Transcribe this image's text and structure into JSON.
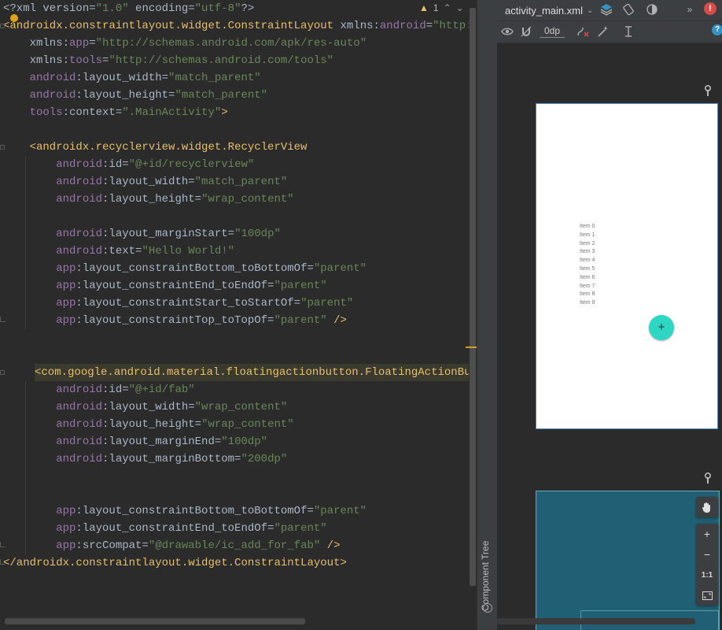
{
  "editor": {
    "lines": [
      [
        {
          "t": "<?xml version=",
          "c": "def"
        },
        {
          "t": "\"1.0\"",
          "c": "str"
        },
        {
          "t": " encoding=",
          "c": "def"
        },
        {
          "t": "\"utf-8\"",
          "c": "str"
        },
        {
          "t": "?>",
          "c": "def"
        }
      ],
      [
        {
          "t": "<androidx.constraintlayout.widget.ConstraintLayout ",
          "c": "tag"
        },
        {
          "t": "xmlns:",
          "c": "def"
        },
        {
          "t": "android",
          "c": "ns"
        },
        {
          "t": "=",
          "c": "def"
        },
        {
          "t": "\"http://sch",
          "c": "str"
        }
      ],
      [
        {
          "t": "    xmlns:",
          "c": "def"
        },
        {
          "t": "app",
          "c": "ns"
        },
        {
          "t": "=",
          "c": "def"
        },
        {
          "t": "\"http://schemas.android.com/apk/res-auto\"",
          "c": "str"
        }
      ],
      [
        {
          "t": "    xmlns:",
          "c": "def"
        },
        {
          "t": "tools",
          "c": "ns"
        },
        {
          "t": "=",
          "c": "def"
        },
        {
          "t": "\"http://schemas.android.com/tools\"",
          "c": "str"
        }
      ],
      [
        {
          "t": "    android",
          "c": "ns"
        },
        {
          "t": ":layout_width=",
          "c": "def"
        },
        {
          "t": "\"match_parent\"",
          "c": "str"
        }
      ],
      [
        {
          "t": "    android",
          "c": "ns"
        },
        {
          "t": ":layout_height=",
          "c": "def"
        },
        {
          "t": "\"match_parent\"",
          "c": "str"
        }
      ],
      [
        {
          "t": "    tools",
          "c": "ns"
        },
        {
          "t": ":context=",
          "c": "def"
        },
        {
          "t": "\".MainActivity\"",
          "c": "str"
        },
        {
          "t": ">",
          "c": "tag"
        }
      ],
      [],
      [
        {
          "t": "    <androidx.recyclerview.widget.RecyclerView",
          "c": "tag"
        }
      ],
      [
        {
          "t": "        android",
          "c": "ns"
        },
        {
          "t": ":id=",
          "c": "def"
        },
        {
          "t": "\"@+id/recyclerview\"",
          "c": "str"
        }
      ],
      [
        {
          "t": "        android",
          "c": "ns"
        },
        {
          "t": ":layout_width=",
          "c": "def"
        },
        {
          "t": "\"match_parent\"",
          "c": "str"
        }
      ],
      [
        {
          "t": "        android",
          "c": "ns"
        },
        {
          "t": ":layout_height=",
          "c": "def"
        },
        {
          "t": "\"wrap_content\"",
          "c": "str"
        }
      ],
      [],
      [
        {
          "t": "        android",
          "c": "ns"
        },
        {
          "t": ":layout_marginStart=",
          "c": "def"
        },
        {
          "t": "\"100dp\"",
          "c": "str"
        }
      ],
      [
        {
          "t": "        android",
          "c": "ns"
        },
        {
          "t": ":text=",
          "c": "def"
        },
        {
          "t": "\"Hello World!\"",
          "c": "str"
        }
      ],
      [
        {
          "t": "        app",
          "c": "ns"
        },
        {
          "t": ":layout_constraintBottom_toBottomOf=",
          "c": "def"
        },
        {
          "t": "\"parent\"",
          "c": "str"
        }
      ],
      [
        {
          "t": "        app",
          "c": "ns"
        },
        {
          "t": ":layout_constraintEnd_toEndOf=",
          "c": "def"
        },
        {
          "t": "\"parent\"",
          "c": "str"
        }
      ],
      [
        {
          "t": "        app",
          "c": "ns"
        },
        {
          "t": ":layout_constraintStart_toStartOf=",
          "c": "def"
        },
        {
          "t": "\"parent\"",
          "c": "str"
        }
      ],
      [
        {
          "t": "        app",
          "c": "ns"
        },
        {
          "t": ":layout_constraintTop_toTopOf=",
          "c": "def"
        },
        {
          "t": "\"parent\"",
          "c": "str"
        },
        {
          "t": " />",
          "c": "tag"
        }
      ],
      [],
      [],
      [
        {
          "t": "    <",
          "c": "tag"
        },
        {
          "t": "com.google.android.material.floatingactionbutton.FloatingActionButton",
          "c": "tag"
        }
      ],
      [
        {
          "t": "        android",
          "c": "ns"
        },
        {
          "t": ":id=",
          "c": "def"
        },
        {
          "t": "\"@+id/fab\"",
          "c": "str"
        }
      ],
      [
        {
          "t": "        android",
          "c": "ns"
        },
        {
          "t": ":layout_width=",
          "c": "def"
        },
        {
          "t": "\"wrap_content\"",
          "c": "str"
        }
      ],
      [
        {
          "t": "        android",
          "c": "ns"
        },
        {
          "t": ":layout_height=",
          "c": "def"
        },
        {
          "t": "\"wrap_content\"",
          "c": "str"
        }
      ],
      [
        {
          "t": "        android",
          "c": "ns"
        },
        {
          "t": ":layout_marginEnd=",
          "c": "def"
        },
        {
          "t": "\"100dp\"",
          "c": "str"
        }
      ],
      [
        {
          "t": "        android",
          "c": "ns"
        },
        {
          "t": ":layout_marginBottom=",
          "c": "def"
        },
        {
          "t": "\"200dp\"",
          "c": "str"
        }
      ],
      [],
      [],
      [
        {
          "t": "        app",
          "c": "ns"
        },
        {
          "t": ":layout_constraintBottom_toBottomOf=",
          "c": "def"
        },
        {
          "t": "\"parent\"",
          "c": "str"
        }
      ],
      [
        {
          "t": "        app",
          "c": "ns"
        },
        {
          "t": ":layout_constraintEnd_toEndOf=",
          "c": "def"
        },
        {
          "t": "\"parent\"",
          "c": "str"
        }
      ],
      [
        {
          "t": "        app",
          "c": "ns"
        },
        {
          "t": ":srcCompat=",
          "c": "def"
        },
        {
          "t": "\"@drawable/ic_add_for_fab\"",
          "c": "str"
        },
        {
          "t": " />",
          "c": "tag"
        }
      ],
      [
        {
          "t": "</androidx.constraintlayout.widget.ConstraintLayout>",
          "c": "tag"
        }
      ]
    ],
    "highlighted_line": 21,
    "warnings_count": "1"
  },
  "design": {
    "file_tab": "activity_main.xml",
    "default_margin": "0dp",
    "component_tree_label": "Component Tree",
    "recycler_items": [
      "Item 0",
      "Item 1",
      "Item 2",
      "Item 3",
      "Item 4",
      "Item 5",
      "Item 6",
      "Item 7",
      "Item 8",
      "Item 9"
    ],
    "fab_glyph": "+",
    "zoom_in": "+",
    "zoom_out": "−",
    "zoom_reset": "1:1",
    "error_glyph": "!",
    "help_glyph": "?"
  },
  "colors": {
    "tag": "#e8bf6a",
    "attr_namespace": "#9876aa",
    "string": "#6a8759",
    "fab": "#2ed6c4",
    "blueprint": "#215f74"
  }
}
